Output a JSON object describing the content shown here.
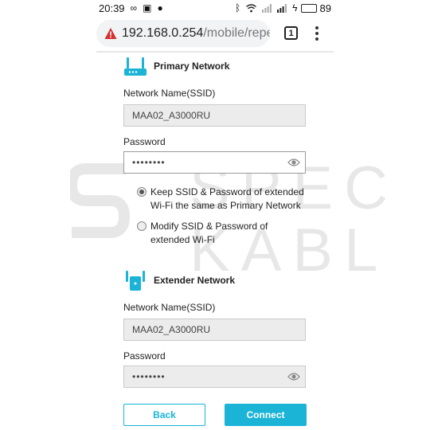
{
  "status_bar": {
    "time": "20:39",
    "battery_level": "89",
    "battery_fraction": 0.89,
    "left_icons": [
      "infinity-icon",
      "image-icon",
      "chat-icon"
    ],
    "right_icons": [
      "bluetooth-icon",
      "wifi-icon",
      "signal-icon",
      "signal-icon",
      "charging-icon",
      "battery-icon"
    ]
  },
  "browser": {
    "url_host": "192.168.0.254",
    "url_path": "/mobile/repeat",
    "tab_count": "1",
    "security_icon": "warning-icon"
  },
  "primary": {
    "title": "Primary Network",
    "ssid_label": "Network Name(SSID)",
    "ssid_value": "MAA02_A3000RU",
    "password_label": "Password",
    "password_value": "••••••••"
  },
  "options": [
    {
      "label": "Keep SSID & Password of extended Wi-Fi the same as Primary Network",
      "checked": true
    },
    {
      "label": "Modify SSID & Password of extended Wi-Fi",
      "checked": false
    }
  ],
  "extender": {
    "title": "Extender Network",
    "ssid_label": "Network Name(SSID)",
    "ssid_value": "MAA02_A3000RU",
    "password_label": "Password",
    "password_value": "••••••••"
  },
  "actions": {
    "back_label": "Back",
    "connect_label": "Connect"
  },
  "colors": {
    "accent": "#1bb4d6",
    "warning": "#d32f2f",
    "battery": "#35c335"
  }
}
